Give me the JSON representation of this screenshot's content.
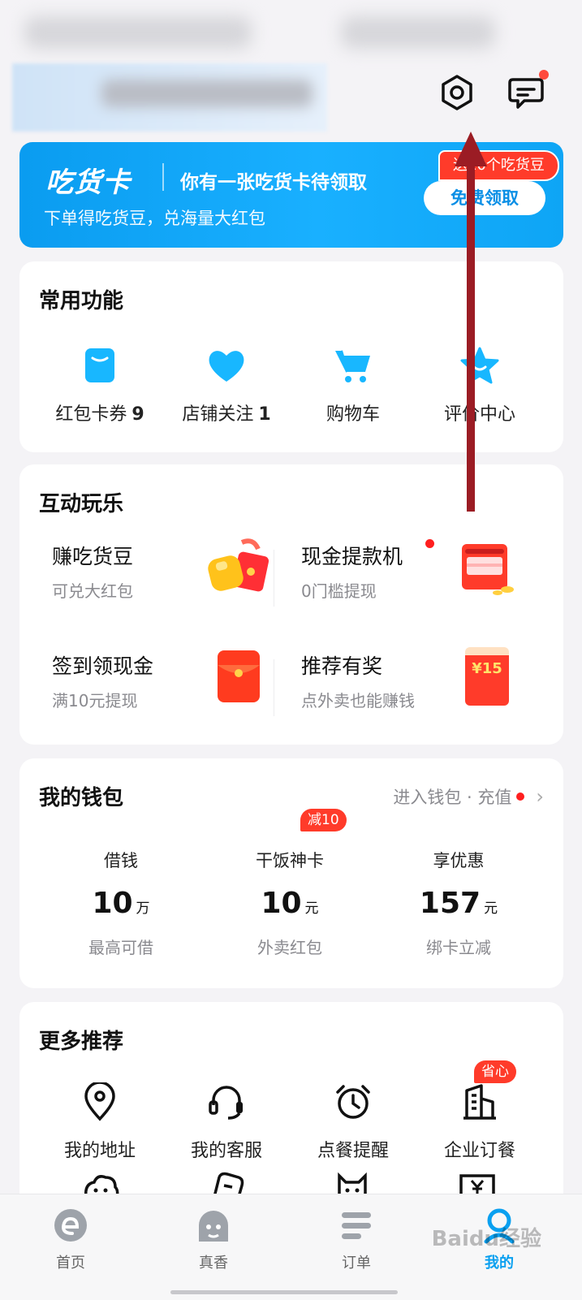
{
  "banner": {
    "logo": "吃货卡",
    "title": "你有一张吃货卡待领取",
    "subtitle": "下单得吃货豆，兑海量大红包",
    "tag": "送10个吃货豆",
    "claim": "免费领取"
  },
  "common": {
    "title": "常用功能",
    "items": [
      {
        "label": "红包卡券",
        "count": "9",
        "icon": "coupon-icon"
      },
      {
        "label": "店铺关注",
        "count": "1",
        "icon": "heart-icon"
      },
      {
        "label": "购物车",
        "count": "",
        "icon": "cart-icon"
      },
      {
        "label": "评价中心",
        "count": "",
        "icon": "star-icon"
      }
    ]
  },
  "fun": {
    "title": "互动玩乐",
    "cells": [
      {
        "title": "赚吃货豆",
        "sub": "可兑大红包",
        "icon": "beans-gift-icon"
      },
      {
        "title": "现金提款机",
        "sub": "0门槛提现",
        "icon": "cash-machine-icon"
      },
      {
        "title": "签到领现金",
        "sub": "满10元提现",
        "icon": "red-envelope-icon"
      },
      {
        "title": "推荐有奖",
        "sub": "点外卖也能赚钱",
        "icon": "reward-envelope-icon",
        "badge": "¥15"
      }
    ]
  },
  "wallet": {
    "title": "我的钱包",
    "link": "进入钱包 · 充值",
    "cols": [
      {
        "head": "借钱",
        "value": "10",
        "unit": "万",
        "foot": "最高可借"
      },
      {
        "head": "干饭神卡",
        "value": "10",
        "unit": "元",
        "foot": "外卖红包",
        "badge": "减10"
      },
      {
        "head": "享优惠",
        "value": "157",
        "unit": "元",
        "foot": "绑卡立减"
      }
    ]
  },
  "more": {
    "title": "更多推荐",
    "items": [
      {
        "label": "我的地址",
        "icon": "location-icon"
      },
      {
        "label": "我的客服",
        "icon": "headset-icon"
      },
      {
        "label": "点餐提醒",
        "icon": "alarm-clock-icon"
      },
      {
        "label": "企业订餐",
        "icon": "building-icon",
        "badge": "省心"
      }
    ]
  },
  "tabs": [
    {
      "label": "首页",
      "icon": "home-e-icon"
    },
    {
      "label": "真香",
      "icon": "zhenxiang-icon"
    },
    {
      "label": "订单",
      "icon": "orders-icon"
    },
    {
      "label": "我的",
      "icon": "profile-icon",
      "active": true
    }
  ],
  "watermark": "Baidu经验",
  "colors": {
    "accent": "#0aa0f0",
    "red": "#ff3b2a",
    "arrow": "#9b1c24"
  }
}
